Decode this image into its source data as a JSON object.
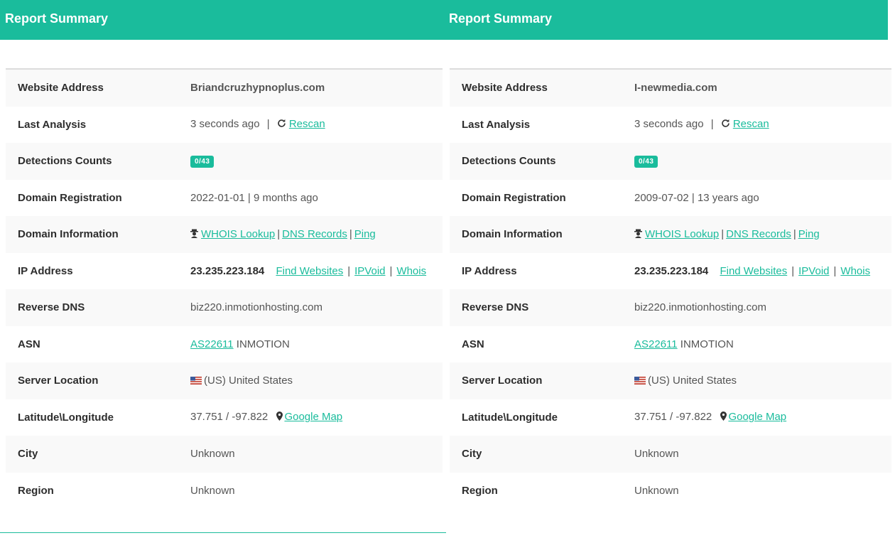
{
  "panels": [
    {
      "header": "Report Summary",
      "website_address": {
        "label": "Website Address",
        "value": "Briandcruzhypnoplus.com"
      },
      "last_analysis": {
        "label": "Last Analysis",
        "time": "3 seconds ago",
        "sep": "|",
        "rescan": "Rescan"
      },
      "detections": {
        "label": "Detections Counts",
        "badge": "0/43"
      },
      "domain_registration": {
        "label": "Domain Registration",
        "value": "2022-01-01 | 9 months ago"
      },
      "domain_information": {
        "label": "Domain Information",
        "whois": "WHOIS Lookup",
        "dns": "DNS Records",
        "ping": "Ping",
        "sep": "|"
      },
      "ip_address": {
        "label": "IP Address",
        "ip": "23.235.223.184",
        "find": "Find Websites",
        "ipvoid": "IPVoid",
        "whois": "Whois",
        "sep": "|"
      },
      "reverse_dns": {
        "label": "Reverse DNS",
        "value": "biz220.inmotionhosting.com"
      },
      "asn": {
        "label": "ASN",
        "asn": "AS22611",
        "org": "INMOTION"
      },
      "server_location": {
        "label": "Server Location",
        "value": "(US) United States"
      },
      "latlong": {
        "label": "Latitude\\Longitude",
        "value": "37.751 / -97.822",
        "map": "Google Map"
      },
      "city": {
        "label": "City",
        "value": "Unknown"
      },
      "region": {
        "label": "Region",
        "value": "Unknown"
      }
    },
    {
      "header": "Report Summary",
      "website_address": {
        "label": "Website Address",
        "value": "I-newmedia.com"
      },
      "last_analysis": {
        "label": "Last Analysis",
        "time": "3 seconds ago",
        "sep": "|",
        "rescan": "Rescan"
      },
      "detections": {
        "label": "Detections Counts",
        "badge": "0/43"
      },
      "domain_registration": {
        "label": "Domain Registration",
        "value": "2009-07-02 | 13 years ago"
      },
      "domain_information": {
        "label": "Domain Information",
        "whois": "WHOIS Lookup",
        "dns": "DNS Records",
        "ping": "Ping",
        "sep": "|"
      },
      "ip_address": {
        "label": "IP Address",
        "ip": "23.235.223.184",
        "find": "Find Websites",
        "ipvoid": "IPVoid",
        "whois": "Whois",
        "sep": "|"
      },
      "reverse_dns": {
        "label": "Reverse DNS",
        "value": "biz220.inmotionhosting.com"
      },
      "asn": {
        "label": "ASN",
        "asn": "AS22611",
        "org": "INMOTION"
      },
      "server_location": {
        "label": "Server Location",
        "value": "(US) United States"
      },
      "latlong": {
        "label": "Latitude\\Longitude",
        "value": "37.751 / -97.822",
        "map": "Google Map"
      },
      "city": {
        "label": "City",
        "value": "Unknown"
      },
      "region": {
        "label": "Region",
        "value": "Unknown"
      }
    }
  ],
  "colors": {
    "accent": "#1abc9c"
  }
}
